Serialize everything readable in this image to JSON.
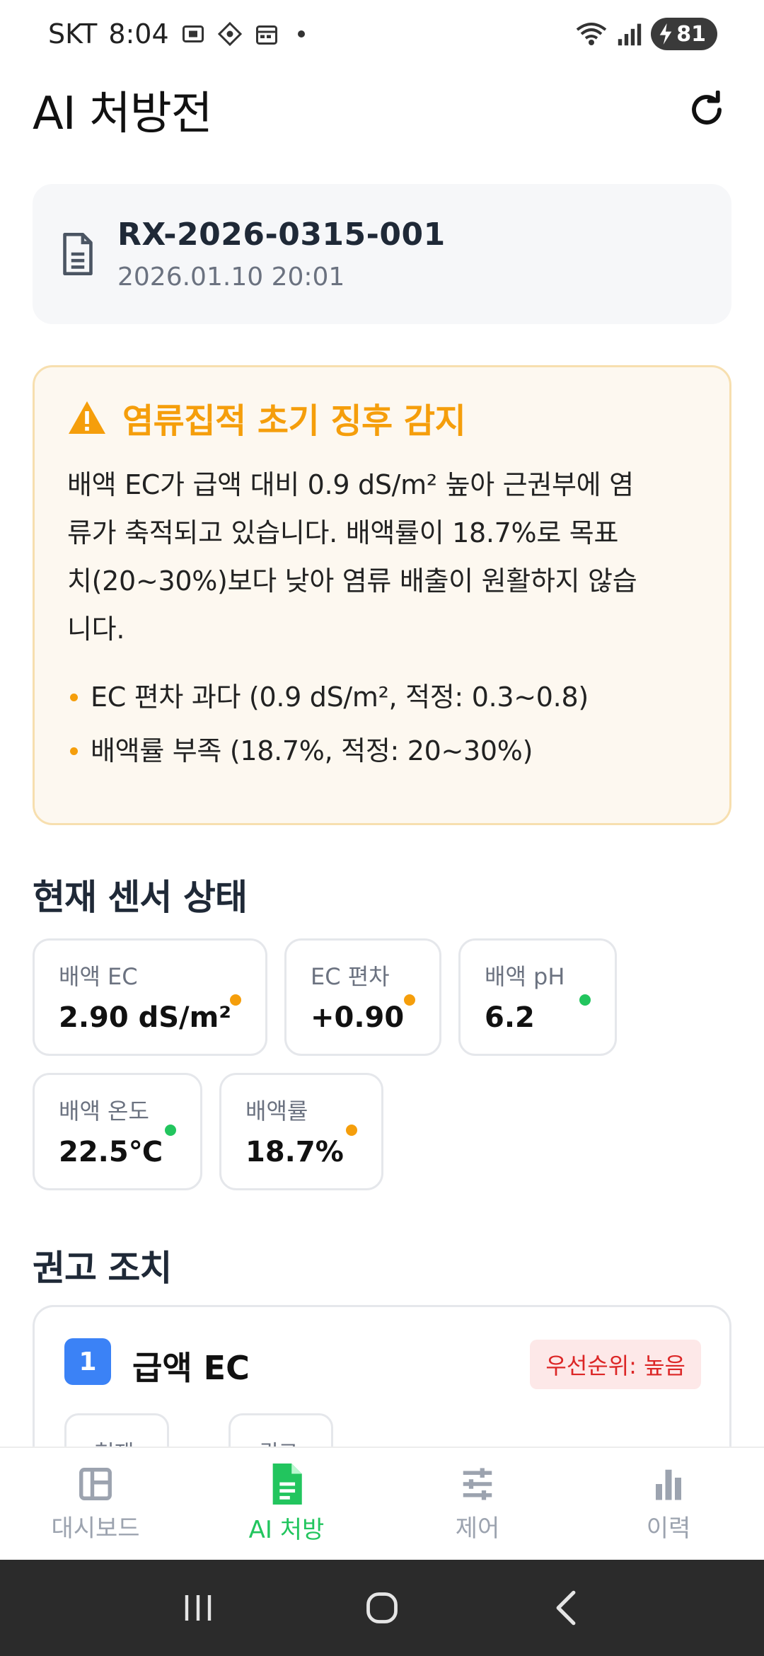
{
  "status_bar": {
    "carrier": "SKT",
    "time": "8:04",
    "battery": "81",
    "icons": [
      "screenshot-icon",
      "vpn-icon",
      "calendar-icon",
      "notification-dot",
      "wifi-icon",
      "signal-icon",
      "battery-charging-icon"
    ]
  },
  "header": {
    "title": "AI 처방전",
    "refresh_icon": "refresh-icon"
  },
  "prescription": {
    "id": "RX-2026-0315-001",
    "date": "2026.01.10 20:01",
    "icon": "document-icon"
  },
  "alert": {
    "icon": "warning-icon",
    "title": "염류집적 초기 징후 감지",
    "body_lines": [
      "배액 EC가 급액 대비 0.9 dS/m² 높아 근권부에 염",
      "류가 축적되고 있습니다. 배액률이 18.7%로 목표",
      "치(20~30%)보다 낮아 염류 배출이 원활하지 않습",
      "니다."
    ],
    "bullets": [
      "EC 편차 과다 (0.9 dS/m², 적정: 0.3~0.8)",
      "배액률 부족 (18.7%, 적정: 20~30%)"
    ],
    "accent_color": "#f59e0b"
  },
  "sensors": {
    "title": "현재 센서 상태",
    "items": [
      {
        "label": "배액 EC",
        "value": "2.90 dS/m²",
        "status": "warning",
        "color": "#f59e0b"
      },
      {
        "label": "EC 편차",
        "value": "+0.90",
        "status": "warning",
        "color": "#f59e0b"
      },
      {
        "label": "배액 pH",
        "value": "6.2",
        "status": "normal",
        "color": "#22c55e"
      },
      {
        "label": "배액 온도",
        "value": "22.5℃",
        "status": "normal",
        "color": "#22c55e"
      },
      {
        "label": "배액률",
        "value": "18.7%",
        "status": "warning",
        "color": "#f59e0b"
      }
    ]
  },
  "recommendations": {
    "title": "권고 조치",
    "items": [
      {
        "number": "1",
        "title": "급액 EC",
        "priority": "우선순위: 높음",
        "sub_labels": [
          "현재",
          "권고"
        ]
      }
    ]
  },
  "bottom_nav": {
    "items": [
      {
        "label": "대시보드",
        "icon": "dashboard-icon",
        "active": false
      },
      {
        "label": "AI 처방",
        "icon": "prescription-icon",
        "active": true
      },
      {
        "label": "제어",
        "icon": "sliders-icon",
        "active": false
      },
      {
        "label": "이력",
        "icon": "bar-chart-icon",
        "active": false
      }
    ],
    "active_color": "#22c55e",
    "inactive_color": "#9ca3af"
  },
  "system_nav": {
    "icons": [
      "recent-apps-icon",
      "home-icon",
      "back-icon"
    ]
  }
}
